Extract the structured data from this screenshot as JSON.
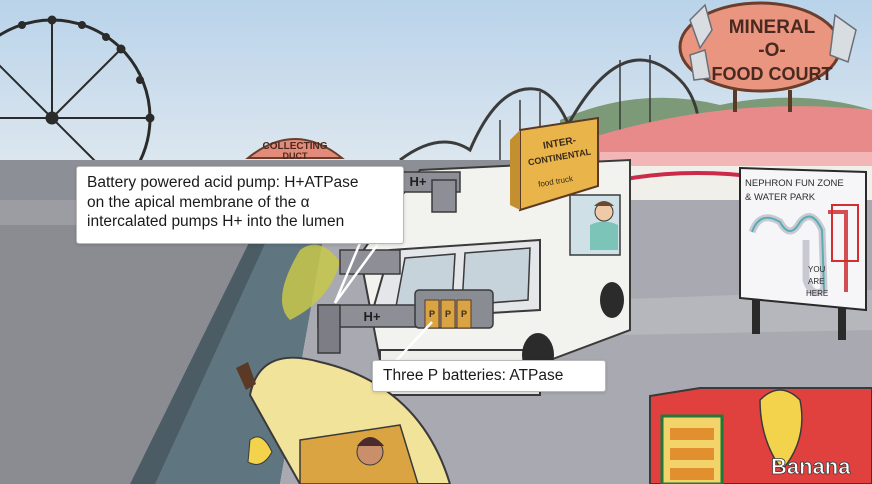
{
  "scene": {
    "signs": {
      "food_court": [
        "MINERAL",
        "-O-",
        "FOOD COURT"
      ],
      "duct": [
        "COLLECTING",
        "DUCT"
      ],
      "truck_top": [
        "INTER-",
        "CONTINENTAL"
      ],
      "truck_sub": "food truck",
      "pipe_upper": "H+",
      "pipe_lower": "H+",
      "batteries": [
        "P",
        "P",
        "P"
      ],
      "nephron_board": [
        "NEPHRON FUN ZONE",
        "& WATER PARK"
      ],
      "you_are_here": [
        "YOU",
        "ARE",
        "HERE"
      ],
      "banana_stand": "Banana"
    }
  },
  "callouts": {
    "acid_pump": {
      "lines": [
        "Battery powered acid pump: H+ATPase",
        "on the apical membrane of the α",
        "intercalated pumps H+ into the lumen"
      ]
    },
    "batteries": {
      "lines": [
        "Three P batteries: ATPase"
      ]
    }
  }
}
